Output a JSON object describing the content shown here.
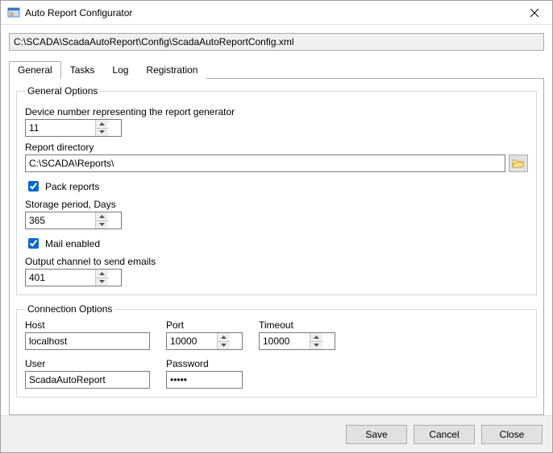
{
  "window": {
    "title": "Auto Report Configurator",
    "config_path": "C:\\SCADA\\ScadaAutoReport\\Config\\ScadaAutoReportConfig.xml"
  },
  "tabs": {
    "general": "General",
    "tasks": "Tasks",
    "log": "Log",
    "registration": "Registration"
  },
  "general_options": {
    "legend": "General Options",
    "device_label": "Device number representing the report generator",
    "device_value": "11",
    "report_dir_label": "Report directory",
    "report_dir_value": "C:\\SCADA\\Reports\\",
    "pack_reports_label": "Pack reports",
    "pack_reports_checked": true,
    "storage_label": "Storage period, Days",
    "storage_value": "365",
    "mail_enabled_label": "Mail enabled",
    "mail_enabled_checked": true,
    "output_channel_label": "Output channel to send emails",
    "output_channel_value": "401"
  },
  "connection": {
    "legend": "Connection Options",
    "host_label": "Host",
    "host_value": "localhost",
    "port_label": "Port",
    "port_value": "10000",
    "timeout_label": "Timeout",
    "timeout_value": "10000",
    "user_label": "User",
    "user_value": "ScadaAutoReport",
    "password_label": "Password",
    "password_value": "•••••"
  },
  "buttons": {
    "save": "Save",
    "cancel": "Cancel",
    "close": "Close"
  }
}
